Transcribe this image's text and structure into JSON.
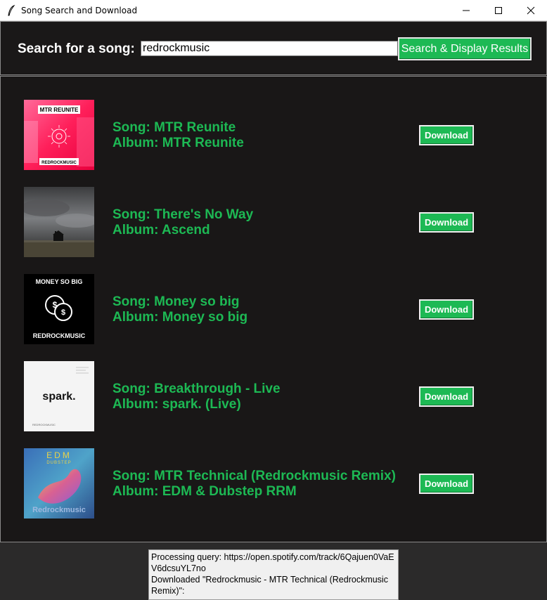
{
  "window": {
    "title": "Song Search and Download",
    "icon": "feather-icon"
  },
  "search": {
    "label": "Search for a song:",
    "query": "redrockmusic",
    "button_label": "Search & Display Results"
  },
  "colors": {
    "accent": "#1db954",
    "background": "#191717",
    "frame_background": "#1a1818"
  },
  "results": [
    {
      "song": "Song: MTR Reunite",
      "album": "Album: MTR Reunite",
      "download_label": "Download",
      "cover": {
        "title": "MTR REUNITE",
        "artist": "REDROCKMUSIC"
      }
    },
    {
      "song": "Song: There's No Way",
      "album": "Album: Ascend",
      "download_label": "Download",
      "cover": {
        "title": "",
        "artist": ""
      }
    },
    {
      "song": "Song: Money so big",
      "album": "Album: Money so big",
      "download_label": "Download",
      "cover": {
        "title": "MONEY SO BIG",
        "artist": "REDROCKMUSIC"
      }
    },
    {
      "song": "Song: Breakthrough - Live",
      "album": "Album: spark. (Live)",
      "download_label": "Download",
      "cover": {
        "title": "spark.",
        "artist": "REDROCKMUSIC"
      }
    },
    {
      "song": "Song: MTR Technical (Redrockmusic Remix)",
      "album": "Album: EDM & Dubstep RRM",
      "download_label": "Download",
      "cover": {
        "title": "EDM",
        "subtitle": "DUBSTEP",
        "artist": "Redrockmusic"
      }
    }
  ],
  "log": {
    "lines": [
      "Processing query: https://open.spotify.com/track/6Qajuen0VaEV6dcsuYL7no",
      "Downloaded \"Redrockmusic - MTR Technical (Redrockmusic Remix)\":"
    ]
  }
}
